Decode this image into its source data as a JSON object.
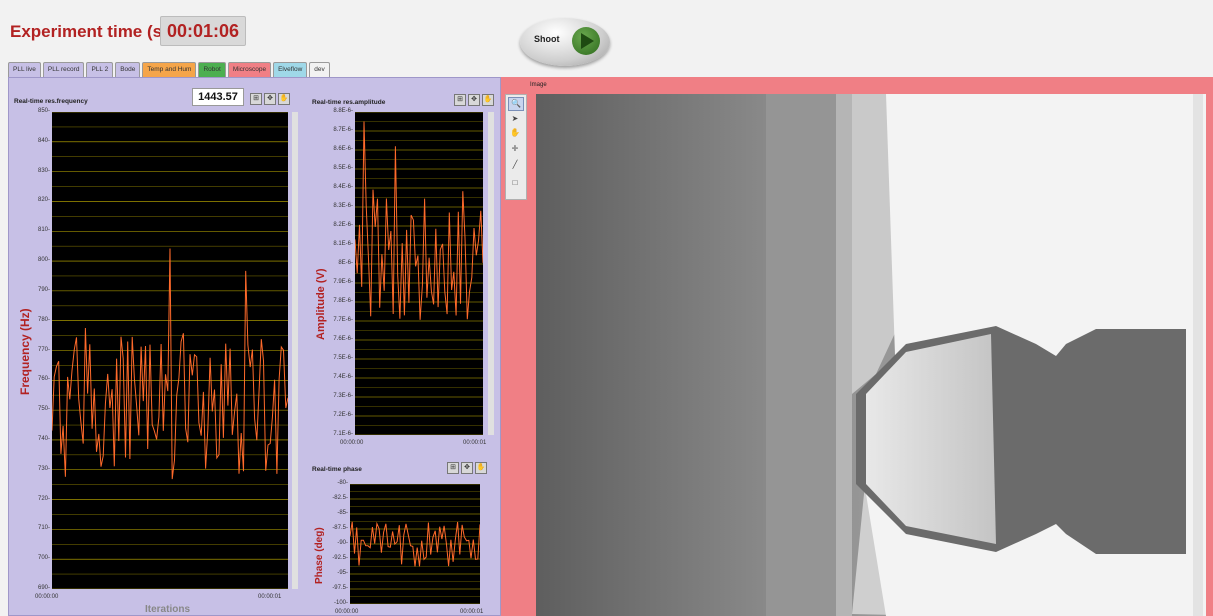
{
  "header": {
    "experiment_label": "Experiment time (s):",
    "experiment_time": "00:01:06",
    "shoot_label": "Shoot"
  },
  "tabs": [
    {
      "label": "PLL live",
      "color": "#c7c0e6"
    },
    {
      "label": "PLL record",
      "color": "#c7c0e6"
    },
    {
      "label": "PLL 2",
      "color": "#c7c0e6"
    },
    {
      "label": "Bode",
      "color": "#c7c0e6"
    },
    {
      "label": "Temp and Hum",
      "color": "#f5a54a"
    },
    {
      "label": "Robot",
      "color": "#4caf50"
    },
    {
      "label": "Microscope",
      "color": "#f07f85"
    },
    {
      "label": "Elveflow",
      "color": "#9fd8e8"
    },
    {
      "label": "dev",
      "color": "#f2f2f2"
    }
  ],
  "graphs": {
    "frequency": {
      "title": "Real-time res.frequency",
      "value_display": "1443.57",
      "y_title": "Frequency (Hz)",
      "x_title": "Iterations",
      "y_ticks": [
        "850-",
        "840-",
        "830-",
        "820-",
        "810-",
        "800-",
        "790-",
        "780-",
        "770-",
        "760-",
        "750-",
        "740-",
        "730-",
        "720-",
        "710-",
        "700-",
        "690-"
      ],
      "x_ticks": [
        "00:00:00",
        "00:00:01"
      ]
    },
    "amplitude": {
      "title": "Real-time res.amplitude",
      "y_title": "Amplitude (V)",
      "y_ticks": [
        "8.8E-6-",
        "8.7E-6-",
        "8.6E-6-",
        "8.5E-6-",
        "8.4E-6-",
        "8.3E-6-",
        "8.2E-6-",
        "8.1E-6-",
        "8E-6-",
        "7.9E-6-",
        "7.8E-6-",
        "7.7E-6-",
        "7.6E-6-",
        "7.5E-6-",
        "7.4E-6-",
        "7.3E-6-",
        "7.2E-6-",
        "7.1E-6-"
      ],
      "x_ticks": [
        "00:00:00",
        "00:00:01"
      ]
    },
    "phase": {
      "title": "Real-time phase",
      "y_title": "Phase (deg)",
      "y_ticks": [
        "-80-",
        "-82.5-",
        "-85-",
        "-87.5-",
        "-90-",
        "-92.5-",
        "-95-",
        "-97.5-",
        "-100-"
      ],
      "x_ticks": [
        "00:00:00",
        "00:00:01"
      ]
    }
  },
  "image_panel": {
    "label": "Image"
  },
  "colors": {
    "line": "#ff6a2b",
    "grid": "#c8b400",
    "panel": "#c7c0e6",
    "microscope": "#f07f85"
  }
}
